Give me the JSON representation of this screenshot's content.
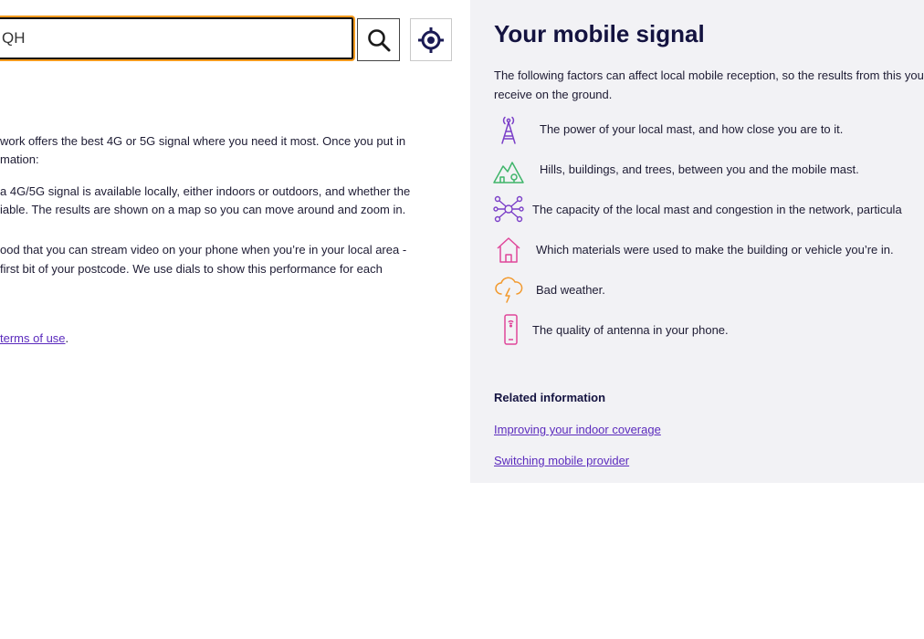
{
  "search": {
    "value": "QH",
    "search_icon": "search-icon",
    "locate_icon": "locate-icon"
  },
  "intro": {
    "lines": [
      "work offers the best 4G or 5G signal where you need it most. Once you put in",
      "mation:",
      " a 4G/5G signal is available locally, either indoors or outdoors, and whether the",
      "iable. The results are shown on a map so you can move around and zoom in.",
      "ood that you can stream video on your phone when you’re in your local area -",
      " first bit of your postcode. We use dials to show this performance for each"
    ],
    "terms_link": "terms of use",
    "terms_suffix": "."
  },
  "panel": {
    "title": "Your mobile signal",
    "intro": "The following factors can affect local mobile reception, so the results from this you receive on the ground.",
    "factors": [
      {
        "icon": "mast-icon",
        "text": "The power of your local mast, and how close you are to it."
      },
      {
        "icon": "hills-icon",
        "text": "Hills, buildings, and trees, between you and the mobile mast."
      },
      {
        "icon": "network-icon",
        "text": "The capacity of the local mast and congestion in the network, particula"
      },
      {
        "icon": "house-icon",
        "text": "Which materials were used to make the building or vehicle you’re in."
      },
      {
        "icon": "weather-icon",
        "text": "Bad weather."
      },
      {
        "icon": "phone-icon",
        "text": "The quality of antenna in your phone."
      }
    ],
    "related_heading": "Related information",
    "related_links": [
      "Improving your indoor coverage",
      "Switching mobile provider"
    ]
  },
  "colors": {
    "accent_link": "#5b2bbd",
    "focus_ring": "#f39a1e",
    "panel_bg": "#f2f2f5",
    "icon_purple": "#7b3fc8",
    "icon_green": "#3fb56a",
    "icon_pink": "#e0469a",
    "icon_orange": "#f29a2e"
  }
}
